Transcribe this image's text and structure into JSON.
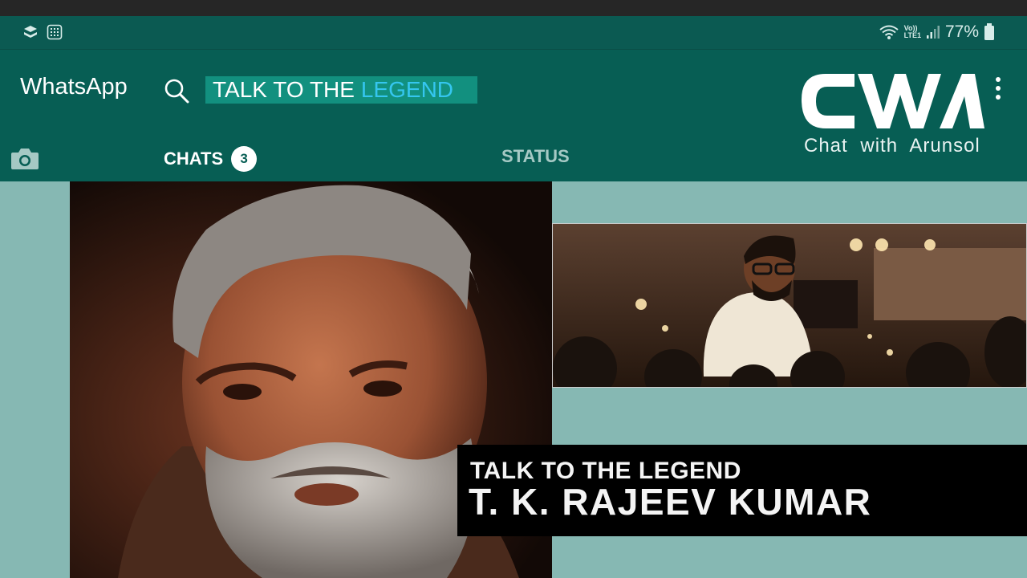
{
  "status_bar": {
    "battery_percent": "77%",
    "network_label_top": "Vo))",
    "network_label_bottom": "LTE1",
    "left_icons": [
      "app-notification-icon",
      "grid-notification-icon"
    ],
    "right_icons": [
      "wifi-icon",
      "signal-icon",
      "battery-icon"
    ]
  },
  "app_bar": {
    "title": "WhatsApp",
    "search_text_white": "TALK TO THE",
    "search_text_blue": "LEGEND",
    "menu_icon": "more-vert-icon"
  },
  "logo": {
    "mark": "CWA",
    "caption": "Chat with Arunsol"
  },
  "tabs": [
    {
      "label": "CHATS",
      "badge": "3",
      "selected": true
    },
    {
      "label": "STATUS",
      "selected": false
    }
  ],
  "caption": {
    "line1": "TALK TO THE LEGEND",
    "line2": "T. K. RAJEEV KUMAR"
  },
  "colors": {
    "app_bar": "#075e54",
    "status_bar": "#0b5a52",
    "background": "#86b8b3",
    "search_highlight": "#12907f",
    "legend_blue": "#35c6ef"
  }
}
